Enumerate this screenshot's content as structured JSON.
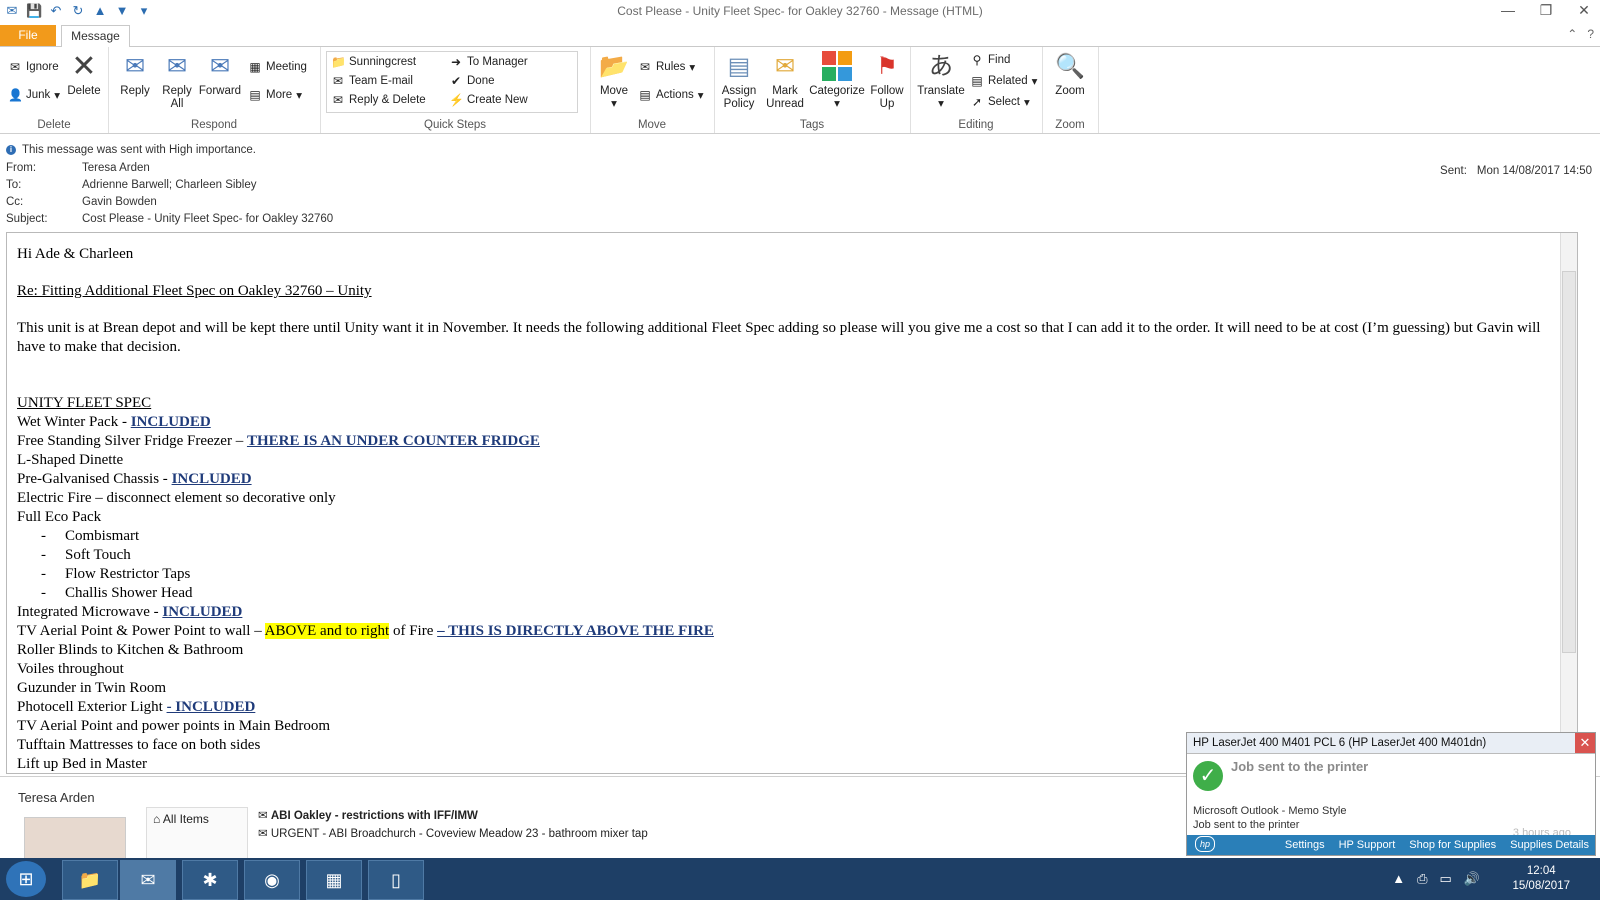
{
  "window": {
    "title": "Cost Please - Unity Fleet Spec- for Oakley 32760  -  Message (HTML)",
    "controls": [
      "—",
      "❐",
      "✕"
    ]
  },
  "tabs": {
    "file": "File",
    "message": "Message"
  },
  "ribbon": {
    "delete": {
      "label": "Delete",
      "ignore": "Ignore",
      "junk": "Junk",
      "delete_btn": "Delete"
    },
    "respond": {
      "label": "Respond",
      "reply": "Reply",
      "reply_all_1": "Reply",
      "reply_all_2": "All",
      "forward": "Forward",
      "meeting": "Meeting",
      "more": "More"
    },
    "quick_steps": {
      "label": "Quick Steps",
      "items": [
        "Sunningcrest",
        "Team E-mail",
        "Reply & Delete",
        "To Manager",
        "Done",
        "Create New"
      ]
    },
    "move": {
      "label": "Move",
      "move_btn": "Move",
      "rules": "Rules",
      "actions": "Actions"
    },
    "tags": {
      "label": "Tags",
      "assign_1": "Assign",
      "assign_2": "Policy",
      "mark_1": "Mark",
      "mark_2": "Unread",
      "categorize": "Categorize",
      "follow_1": "Follow",
      "follow_2": "Up"
    },
    "editing": {
      "label": "Editing",
      "translate": "Translate",
      "find": "Find",
      "related": "Related",
      "select": "Select"
    },
    "zoom": {
      "label": "Zoom",
      "zoom_btn": "Zoom"
    }
  },
  "header": {
    "importance": "This message was sent with High importance.",
    "from_label": "From:",
    "from": "Teresa Arden",
    "to_label": "To:",
    "to": "Adrienne Barwell; Charleen Sibley",
    "cc_label": "Cc:",
    "cc": "Gavin Bowden",
    "subject_label": "Subject:",
    "subject": "Cost Please - Unity Fleet Spec- for Oakley 32760",
    "sent_label": "Sent:",
    "sent": "Mon 14/08/2017 14:50"
  },
  "body": {
    "greeting": "Hi Ade & Charleen",
    "re": "Re: Fitting Additional Fleet Spec on Oakley 32760 – Unity",
    "para": "This unit is at Brean depot and will be kept there until Unity want it in November.  It needs the following additional Fleet Spec adding so please will you give me a cost so that I can add it to the order.  It will need to be at cost (I’m guessing) but Gavin will have to make that decision.",
    "spec_title": "UNITY FLEET SPEC",
    "l1": "Wet Winter Pack - ",
    "l1b": "INCLUDED",
    "l2": "Free Standing Silver Fridge Freezer – ",
    "l2b": "THERE IS AN UNDER COUNTER FRIDGE",
    "l3": "L-Shaped Dinette",
    "l4": "Pre-Galvanised Chassis - ",
    "l4b": "INCLUDED",
    "l5": "Electric Fire – disconnect element so decorative only",
    "l6": "Full Eco Pack",
    "dash": "-",
    "b1": "Combismart",
    "b2": "Soft Touch",
    "b3": "Flow Restrictor Taps",
    "b4": "Challis Shower Head",
    "l7": "Integrated Microwave - ",
    "l7b": "INCLUDED",
    "l8a": "TV Aerial Point & Power Point to wall – ",
    "l8h": "ABOVE and to right",
    "l8c": " of Fire ",
    "l8b": "– THIS IS DIRECTLY ABOVE THE FIRE",
    "l9": "Roller Blinds to Kitchen & Bathroom",
    "l10": "Voiles throughout",
    "l11": "Guzunder in Twin Room",
    "l12": "Photocell Exterior Light ",
    "l12b": "- INCLUDED",
    "l13": "TV Aerial Point and power points in Main Bedroom",
    "l14": "Tufftain Mattresses to face on both sides",
    "l15": "Lift up Bed in Master"
  },
  "people_pane": {
    "name": "Teresa Arden",
    "all_items": "All Items",
    "messages": [
      "ABI Oakley - restrictions with IFF/IMW",
      "URGENT - ABI Broadchurch - Coveview Meadow 23 - bathroom mixer tap"
    ]
  },
  "toast": {
    "title": "HP LaserJet 400 M401 PCL 6 (HP LaserJet 400 M401dn)",
    "status": "Job sent to the printer",
    "source": "Microsoft Outlook - Memo Style",
    "message": "Job sent to the printer",
    "time": "3 hours ago",
    "links": [
      "Settings",
      "HP Support",
      "Shop for Supplies",
      "Supplies Details"
    ]
  },
  "taskbar": {
    "time": "12:04",
    "date": "15/08/2017"
  },
  "colors": {
    "file_tab": "#f29a1b",
    "link_blue": "#1f3b7a",
    "highlight": "#ffff00",
    "taskbar": "#1e3f66"
  }
}
